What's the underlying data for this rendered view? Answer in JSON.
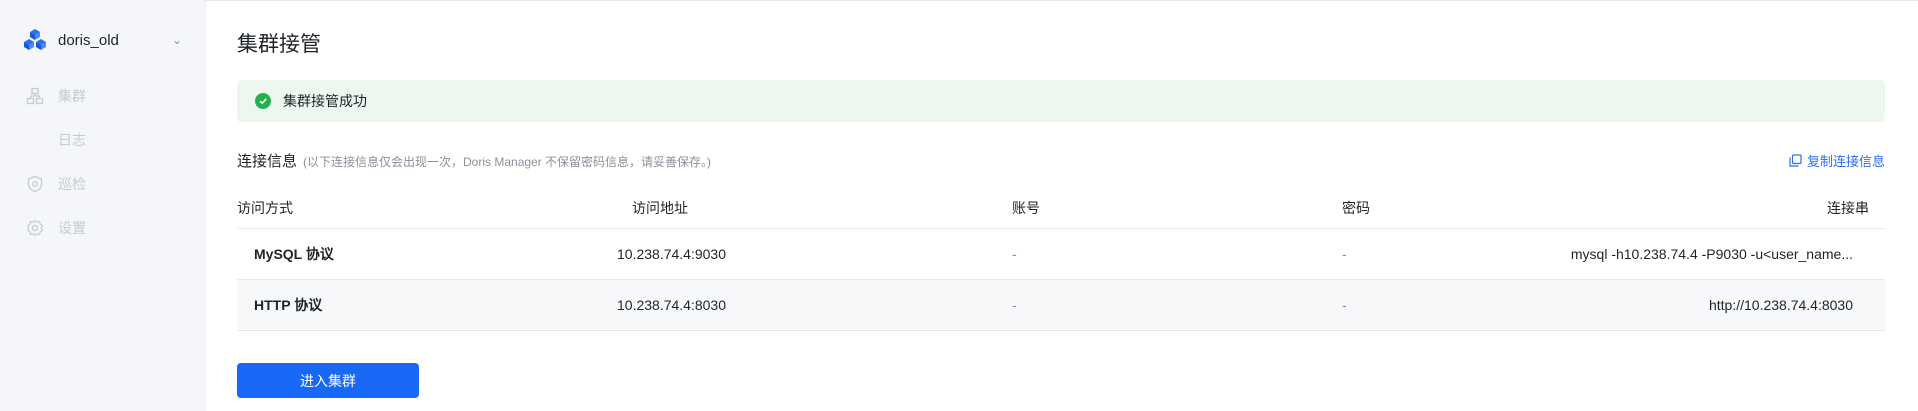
{
  "sidebar": {
    "brand": {
      "name": "doris_old",
      "icon": "cubes-logo-icon"
    },
    "items": [
      {
        "label": "集群",
        "icon": "cluster-icon"
      },
      {
        "label": "日志"
      },
      {
        "label": "巡检",
        "icon": "shield-icon"
      },
      {
        "label": "设置",
        "icon": "gear-icon"
      }
    ]
  },
  "main": {
    "title": "集群接管",
    "alert": {
      "message": "集群接管成功",
      "icon": "check-circle-icon"
    },
    "connection": {
      "title": "连接信息",
      "note": "(以下连接信息仅会出现一次，Doris Manager 不保留密码信息，请妥善保存。)",
      "copy_label": "复制连接信息"
    },
    "table": {
      "columns": [
        "访问方式",
        "访问地址",
        "账号",
        "密码",
        "连接串"
      ],
      "rows": [
        [
          "MySQL 协议",
          "10.238.74.4:9030",
          "-",
          "-",
          "mysql -h10.238.74.4 -P9030 -u<user_name..."
        ],
        [
          "HTTP 协议",
          "10.238.74.4:8030",
          "-",
          "-",
          "http://10.238.74.4:8030"
        ]
      ]
    },
    "enter_button": "进入集群"
  },
  "colors": {
    "accent": "#1668f5",
    "success": "#22b14c",
    "success_bg": "#ecf8ef"
  }
}
